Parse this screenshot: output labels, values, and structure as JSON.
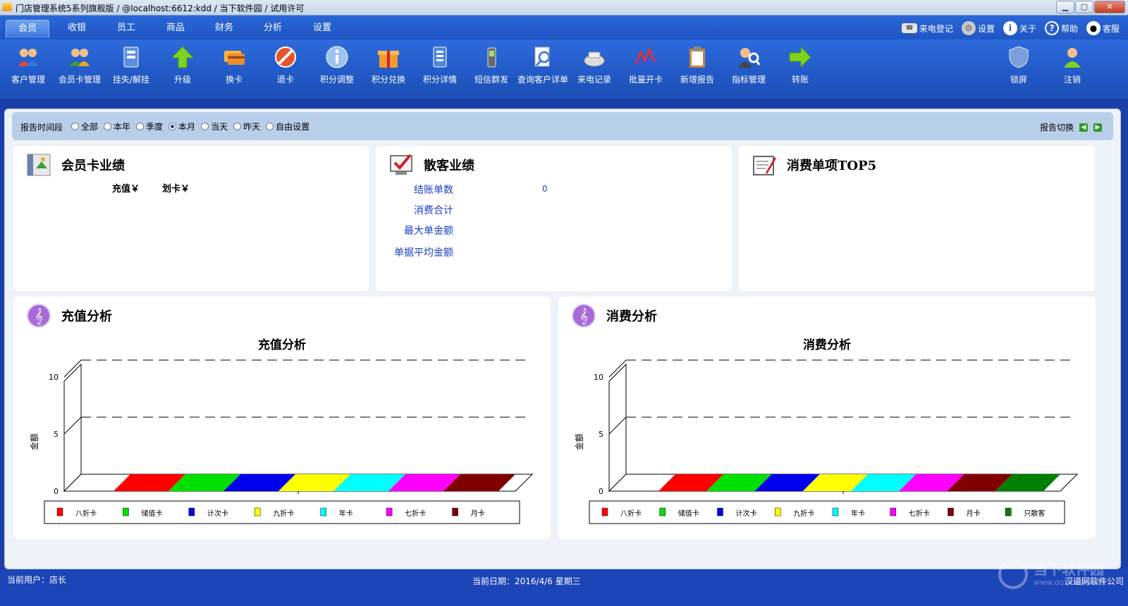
{
  "window": {
    "title": "门店管理系统5系列旗舰版 / @localhost:6612:kdd / 当下软件园 / 试用许可",
    "controls": [
      "minimize",
      "maximize",
      "close"
    ]
  },
  "menu": {
    "tabs": [
      "会员",
      "收银",
      "员工",
      "商品",
      "财务",
      "分析",
      "设置"
    ],
    "active": "会员",
    "right_items": [
      {
        "label": "来电登记",
        "icon": "phone-icon"
      },
      {
        "label": "设置",
        "icon": "gear-icon"
      },
      {
        "label": "关于",
        "icon": "info-icon"
      },
      {
        "label": "帮助",
        "icon": "help-icon"
      },
      {
        "label": "客服",
        "icon": "qq-icon"
      }
    ]
  },
  "toolbar": {
    "items": [
      {
        "label": "客户管理",
        "icon": "customers-icon"
      },
      {
        "label": "会员卡管理",
        "icon": "member-card-icon"
      },
      {
        "label": "挂失/解挂",
        "icon": "report-loss-icon"
      },
      {
        "label": "升级",
        "icon": "upgrade-arrow-icon"
      },
      {
        "label": "换卡",
        "icon": "card-swap-icon"
      },
      {
        "label": "退卡",
        "icon": "refund-card-icon"
      },
      {
        "label": "积分调整",
        "icon": "points-adjust-icon"
      },
      {
        "label": "积分兑换",
        "icon": "gift-icon"
      },
      {
        "label": "积分详情",
        "icon": "points-detail-icon"
      },
      {
        "label": "短信群发",
        "icon": "mobile-phone-icon"
      },
      {
        "label": "查询客户详单",
        "icon": "search-document-icon"
      },
      {
        "label": "来电记录",
        "icon": "call-record-icon"
      },
      {
        "label": "批量开卡",
        "icon": "batch-card-icon"
      },
      {
        "label": "新增报告",
        "icon": "clipboard-icon"
      },
      {
        "label": "指标管理",
        "icon": "indicator-icon"
      },
      {
        "label": "转账",
        "icon": "transfer-arrow-icon"
      }
    ],
    "right_items": [
      {
        "label": "锁屏",
        "icon": "shield-lock-icon"
      },
      {
        "label": "注销",
        "icon": "logout-user-icon"
      }
    ]
  },
  "filter": {
    "label": "报告时间段",
    "options": [
      "全部",
      "本年",
      "季度",
      "本月",
      "当天",
      "昨天",
      "自由设置"
    ],
    "selected": "本月",
    "switch_label": "报告切换"
  },
  "panels": {
    "member_card": {
      "title": "会员卡业绩",
      "recharge_label": "充值￥",
      "swipe_label": "划卡￥"
    },
    "walkin": {
      "title": "散客业绩",
      "rows": [
        {
          "label": "结账单数",
          "value": "0"
        },
        {
          "label": "消费合计",
          "value": ""
        },
        {
          "label": "最大单金额",
          "value": ""
        },
        {
          "label": "单据平均金额",
          "value": ""
        }
      ]
    },
    "top5": {
      "title": "消费单项TOP5"
    },
    "recharge_analysis": {
      "title": "充值分析"
    },
    "consume_analysis": {
      "title": "消费分析"
    }
  },
  "chart_data": [
    {
      "type": "bar",
      "title": "充值分析",
      "ylabel": "金额",
      "ylim": [
        0,
        10
      ],
      "yticks": [
        0,
        5,
        10
      ],
      "grid": true,
      "legend": "bottom",
      "categories": [
        "八折卡",
        "储值卡",
        "计次卡",
        "九折卡",
        "年卡",
        "七折卡",
        "月卡"
      ],
      "values": [
        0,
        0,
        0,
        0,
        0,
        0,
        0
      ],
      "colors": [
        "#ff0000",
        "#00e000",
        "#0000ee",
        "#ffff00",
        "#00ffff",
        "#ff00ff",
        "#800000"
      ]
    },
    {
      "type": "bar",
      "title": "消费分析",
      "ylabel": "金额",
      "ylim": [
        0,
        10
      ],
      "yticks": [
        0,
        5,
        10
      ],
      "grid": true,
      "legend": "bottom",
      "categories": [
        "八折卡",
        "储值卡",
        "计次卡",
        "九折卡",
        "年卡",
        "七折卡",
        "月卡",
        "只散客"
      ],
      "values": [
        0,
        0,
        0,
        0,
        0,
        0,
        0,
        0
      ],
      "colors": [
        "#ff0000",
        "#00e000",
        "#0000ee",
        "#ffff00",
        "#00ffff",
        "#ff00ff",
        "#800000",
        "#008000"
      ]
    }
  ],
  "status": {
    "user": "当前用户：店长",
    "date": "当前日期：2016/4/6 星期三",
    "company": "汉道网软件公司"
  },
  "watermark": {
    "text": "当下软件园",
    "url": "www.downxia.com"
  }
}
